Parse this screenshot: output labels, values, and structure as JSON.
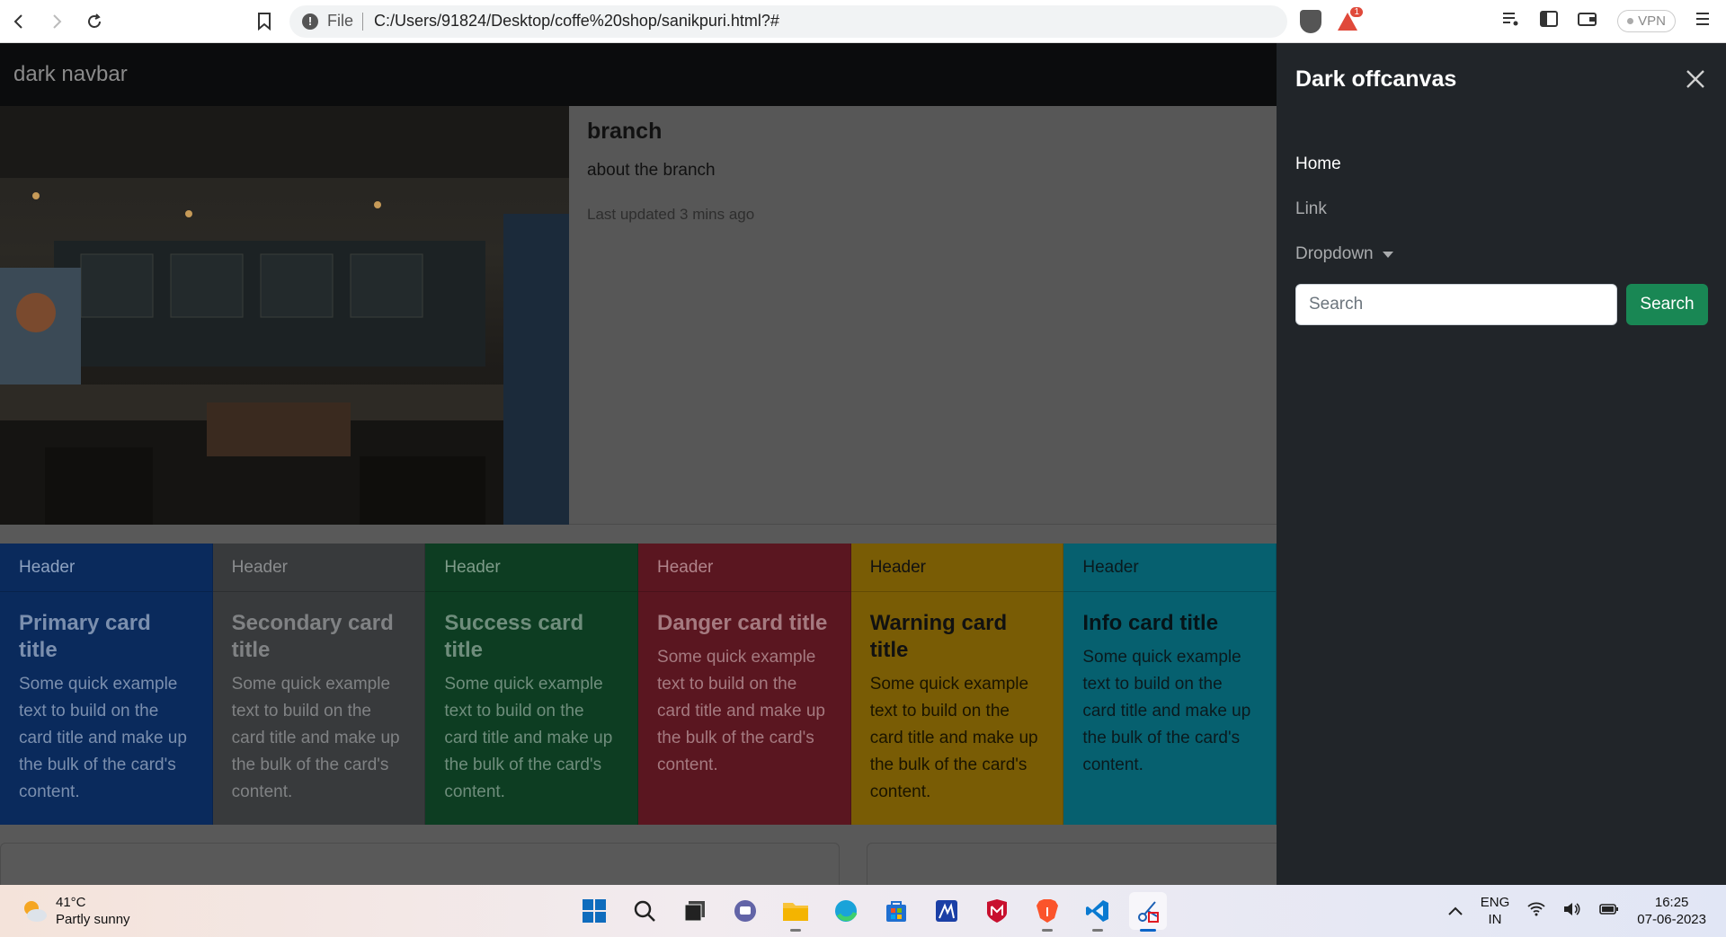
{
  "browser": {
    "url": "C:/Users/91824/Desktop/coffe%20shop/sanikpuri.html?#",
    "file_label": "File",
    "vpn_label": "VPN",
    "alert_count": "1"
  },
  "navbar": {
    "brand": "dark navbar"
  },
  "branch": {
    "title": "branch",
    "text": "about the branch",
    "updated": "Last updated 3 mins ago"
  },
  "cards": [
    {
      "header": "Header",
      "title": "Primary card title",
      "text": "Some quick example text to build on the card title and make up the bulk of the card's content.",
      "bg": "#0a2a5c",
      "header_color": "#8ea2c0",
      "title_color": "#7b8fae",
      "text_color": "#7b8fae"
    },
    {
      "header": "Header",
      "title": "Secondary card title",
      "text": "Some quick example text to build on the card title and make up the bulk of the card's content.",
      "bg": "#383a3c",
      "header_color": "#8a8c8e",
      "title_color": "#808284",
      "text_color": "#808284"
    },
    {
      "header": "Header",
      "title": "Success card title",
      "text": "Some quick example text to build on the card title and make up the bulk of the card's content.",
      "bg": "#0d3d22",
      "header_color": "#7f9c8a",
      "title_color": "#6f8d7c",
      "text_color": "#6f8d7c"
    },
    {
      "header": "Header",
      "title": "Danger card title",
      "text": "Some quick example text to build on the card title and make up the bulk of the card's content.",
      "bg": "#5a1620",
      "header_color": "#b0838a",
      "title_color": "#a57a80",
      "text_color": "#a57a80"
    },
    {
      "header": "Header",
      "title": "Warning card title",
      "text": "Some quick example text to build on the card title and make up the bulk of the card's content.",
      "bg": "#795c05",
      "header_color": "#111111",
      "title_color": "#111111",
      "text_color": "#1a1400"
    },
    {
      "header": "Header",
      "title": "Info card title",
      "text": "Some quick example text to build on the card title and make up the bulk of the card's content.",
      "bg": "#06606f",
      "header_color": "#0a1a1e",
      "title_color": "#061418",
      "text_color": "#0a1a1e"
    }
  ],
  "offcanvas": {
    "title": "Dark offcanvas",
    "links": [
      {
        "label": "Home",
        "active": true
      },
      {
        "label": "Link",
        "active": false
      },
      {
        "label": "Dropdown",
        "active": false,
        "dropdown": true
      }
    ],
    "search_placeholder": "Search",
    "search_button": "Search",
    "accent": "#198754"
  },
  "taskbar": {
    "weather_temp": "41°C",
    "weather_desc": "Partly sunny",
    "apps": [
      "start-icon",
      "search-icon",
      "task-view-icon",
      "teams-chat-icon",
      "file-explorer-icon",
      "edge-icon",
      "store-icon",
      "app-icon",
      "mcafee-icon",
      "brave-icon",
      "vscode-icon",
      "snipping-tool-icon"
    ],
    "lang_top": "ENG",
    "lang_bottom": "IN",
    "time": "16:25",
    "date": "07-06-2023"
  }
}
